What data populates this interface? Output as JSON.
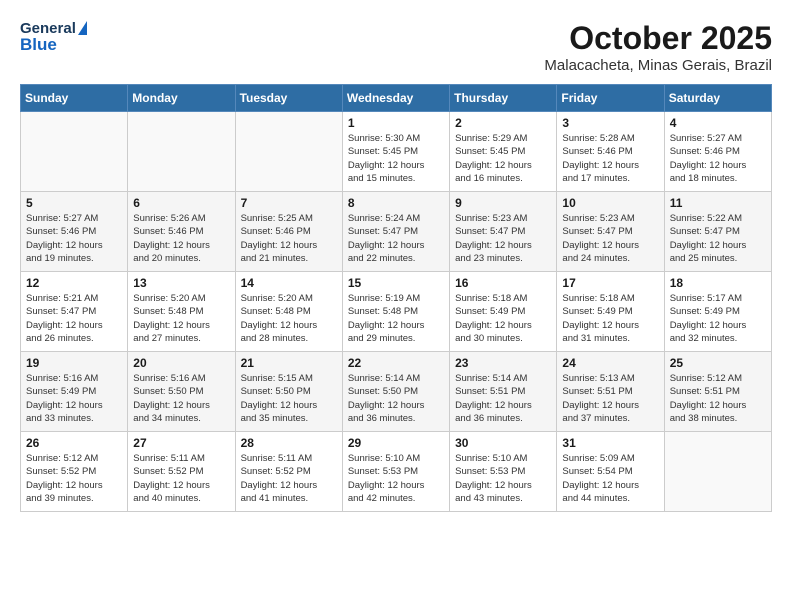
{
  "header": {
    "logo_general": "General",
    "logo_blue": "Blue",
    "month_title": "October 2025",
    "subtitle": "Malacacheta, Minas Gerais, Brazil"
  },
  "calendar": {
    "days_of_week": [
      "Sunday",
      "Monday",
      "Tuesday",
      "Wednesday",
      "Thursday",
      "Friday",
      "Saturday"
    ],
    "weeks": [
      [
        {
          "day": "",
          "info": ""
        },
        {
          "day": "",
          "info": ""
        },
        {
          "day": "",
          "info": ""
        },
        {
          "day": "1",
          "info": "Sunrise: 5:30 AM\nSunset: 5:45 PM\nDaylight: 12 hours\nand 15 minutes."
        },
        {
          "day": "2",
          "info": "Sunrise: 5:29 AM\nSunset: 5:45 PM\nDaylight: 12 hours\nand 16 minutes."
        },
        {
          "day": "3",
          "info": "Sunrise: 5:28 AM\nSunset: 5:46 PM\nDaylight: 12 hours\nand 17 minutes."
        },
        {
          "day": "4",
          "info": "Sunrise: 5:27 AM\nSunset: 5:46 PM\nDaylight: 12 hours\nand 18 minutes."
        }
      ],
      [
        {
          "day": "5",
          "info": "Sunrise: 5:27 AM\nSunset: 5:46 PM\nDaylight: 12 hours\nand 19 minutes."
        },
        {
          "day": "6",
          "info": "Sunrise: 5:26 AM\nSunset: 5:46 PM\nDaylight: 12 hours\nand 20 minutes."
        },
        {
          "day": "7",
          "info": "Sunrise: 5:25 AM\nSunset: 5:46 PM\nDaylight: 12 hours\nand 21 minutes."
        },
        {
          "day": "8",
          "info": "Sunrise: 5:24 AM\nSunset: 5:47 PM\nDaylight: 12 hours\nand 22 minutes."
        },
        {
          "day": "9",
          "info": "Sunrise: 5:23 AM\nSunset: 5:47 PM\nDaylight: 12 hours\nand 23 minutes."
        },
        {
          "day": "10",
          "info": "Sunrise: 5:23 AM\nSunset: 5:47 PM\nDaylight: 12 hours\nand 24 minutes."
        },
        {
          "day": "11",
          "info": "Sunrise: 5:22 AM\nSunset: 5:47 PM\nDaylight: 12 hours\nand 25 minutes."
        }
      ],
      [
        {
          "day": "12",
          "info": "Sunrise: 5:21 AM\nSunset: 5:47 PM\nDaylight: 12 hours\nand 26 minutes."
        },
        {
          "day": "13",
          "info": "Sunrise: 5:20 AM\nSunset: 5:48 PM\nDaylight: 12 hours\nand 27 minutes."
        },
        {
          "day": "14",
          "info": "Sunrise: 5:20 AM\nSunset: 5:48 PM\nDaylight: 12 hours\nand 28 minutes."
        },
        {
          "day": "15",
          "info": "Sunrise: 5:19 AM\nSunset: 5:48 PM\nDaylight: 12 hours\nand 29 minutes."
        },
        {
          "day": "16",
          "info": "Sunrise: 5:18 AM\nSunset: 5:49 PM\nDaylight: 12 hours\nand 30 minutes."
        },
        {
          "day": "17",
          "info": "Sunrise: 5:18 AM\nSunset: 5:49 PM\nDaylight: 12 hours\nand 31 minutes."
        },
        {
          "day": "18",
          "info": "Sunrise: 5:17 AM\nSunset: 5:49 PM\nDaylight: 12 hours\nand 32 minutes."
        }
      ],
      [
        {
          "day": "19",
          "info": "Sunrise: 5:16 AM\nSunset: 5:49 PM\nDaylight: 12 hours\nand 33 minutes."
        },
        {
          "day": "20",
          "info": "Sunrise: 5:16 AM\nSunset: 5:50 PM\nDaylight: 12 hours\nand 34 minutes."
        },
        {
          "day": "21",
          "info": "Sunrise: 5:15 AM\nSunset: 5:50 PM\nDaylight: 12 hours\nand 35 minutes."
        },
        {
          "day": "22",
          "info": "Sunrise: 5:14 AM\nSunset: 5:50 PM\nDaylight: 12 hours\nand 36 minutes."
        },
        {
          "day": "23",
          "info": "Sunrise: 5:14 AM\nSunset: 5:51 PM\nDaylight: 12 hours\nand 36 minutes."
        },
        {
          "day": "24",
          "info": "Sunrise: 5:13 AM\nSunset: 5:51 PM\nDaylight: 12 hours\nand 37 minutes."
        },
        {
          "day": "25",
          "info": "Sunrise: 5:12 AM\nSunset: 5:51 PM\nDaylight: 12 hours\nand 38 minutes."
        }
      ],
      [
        {
          "day": "26",
          "info": "Sunrise: 5:12 AM\nSunset: 5:52 PM\nDaylight: 12 hours\nand 39 minutes."
        },
        {
          "day": "27",
          "info": "Sunrise: 5:11 AM\nSunset: 5:52 PM\nDaylight: 12 hours\nand 40 minutes."
        },
        {
          "day": "28",
          "info": "Sunrise: 5:11 AM\nSunset: 5:52 PM\nDaylight: 12 hours\nand 41 minutes."
        },
        {
          "day": "29",
          "info": "Sunrise: 5:10 AM\nSunset: 5:53 PM\nDaylight: 12 hours\nand 42 minutes."
        },
        {
          "day": "30",
          "info": "Sunrise: 5:10 AM\nSunset: 5:53 PM\nDaylight: 12 hours\nand 43 minutes."
        },
        {
          "day": "31",
          "info": "Sunrise: 5:09 AM\nSunset: 5:54 PM\nDaylight: 12 hours\nand 44 minutes."
        },
        {
          "day": "",
          "info": ""
        }
      ]
    ]
  }
}
